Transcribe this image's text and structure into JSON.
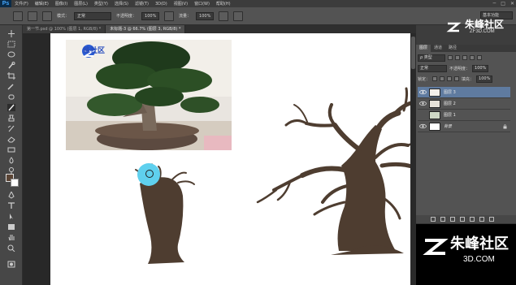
{
  "app": {
    "logo": "Ps"
  },
  "menubar": {
    "items": [
      "文件(F)",
      "编辑(E)",
      "图像(I)",
      "图层(L)",
      "类型(Y)",
      "选择(S)",
      "滤镜(T)",
      "3D(D)",
      "视图(V)",
      "窗口(W)",
      "帮助(H)"
    ],
    "controls": [
      "─",
      "□",
      "✕"
    ]
  },
  "options": {
    "mode_label": "模式：",
    "mode_value": "正常",
    "opacity_label": "不透明度：",
    "opacity_value": "100%",
    "flow_label": "流量：",
    "flow_value": "100%",
    "workspace": "基本功能"
  },
  "tabs": [
    {
      "label": "第一节.psd @ 100% (图层 1, RGB/8) *",
      "active": false
    },
    {
      "label": "未标题-3 @ 66.7% (图层 3, RGB/8) *",
      "active": true
    }
  ],
  "canvas": {
    "photo_logo": "峰社区"
  },
  "panel": {
    "tabs": [
      "图层",
      "通道",
      "路径"
    ],
    "filter_kind": "ρ 类型",
    "blend_mode": "正常",
    "opacity_label": "不透明度：",
    "opacity_value": "100%",
    "lock_label": "锁定：",
    "fill_label": "填充：",
    "fill_value": "100%",
    "layers": [
      {
        "name": "图层 3",
        "selected": true,
        "visible": true
      },
      {
        "name": "图层 2",
        "selected": false,
        "visible": true
      },
      {
        "name": "图层 1",
        "selected": false,
        "visible": false
      },
      {
        "name": "背景",
        "selected": false,
        "visible": true
      }
    ]
  },
  "watermark": {
    "top_text": "朱峰社区",
    "top_sub": "ZF3D.COM",
    "corner_text": "朱峰社区",
    "corner_sub": "3D.COM"
  },
  "colors": {
    "foreground": "#5a4435",
    "background": "#ffffff",
    "tree": "#4e3d30",
    "brush_cursor": "#5fd0ee",
    "selected_layer": "#5f7ba0"
  }
}
